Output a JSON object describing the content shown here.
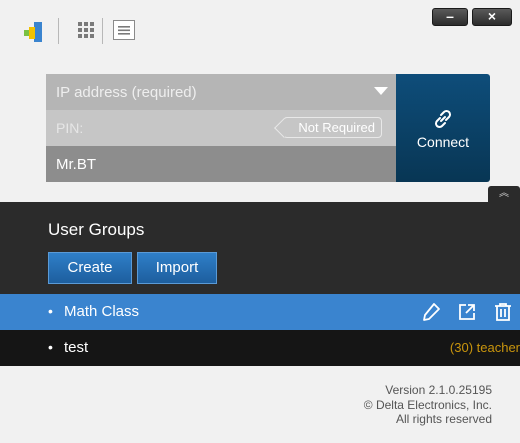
{
  "titlebar": {
    "minimize_label": "–",
    "close_label": "×",
    "icons": [
      "app-logo-icon",
      "grid-icon",
      "menu-icon"
    ]
  },
  "connection": {
    "ip_placeholder": "IP address (required)",
    "pin_label": "PIN:",
    "pin_badge": "Not Required",
    "name_value": "Mr.BT",
    "connect_label": "Connect",
    "connect_icon": "link-icon"
  },
  "user_groups": {
    "title": "User Groups",
    "create_label": "Create",
    "import_label": "Import",
    "collapse_icon": "double-chevron-up-icon",
    "items": [
      {
        "bullet": "•",
        "name": "Math Class",
        "selected": true,
        "actions": [
          "pencil-icon",
          "export-icon",
          "trash-icon"
        ]
      },
      {
        "bullet": "•",
        "name": "test",
        "selected": false,
        "count_text": "(30) teacher"
      }
    ]
  },
  "footer": {
    "version": "Version 2.1.0.25195",
    "copyright": "© Delta Electronics, Inc.",
    "rights": "All rights reserved"
  },
  "colors": {
    "accent_blue": "#3a84cf",
    "connect_bg": "#0e4d7a",
    "dark_bg": "#2b2b2b",
    "teacher_orange": "#c9950d"
  }
}
